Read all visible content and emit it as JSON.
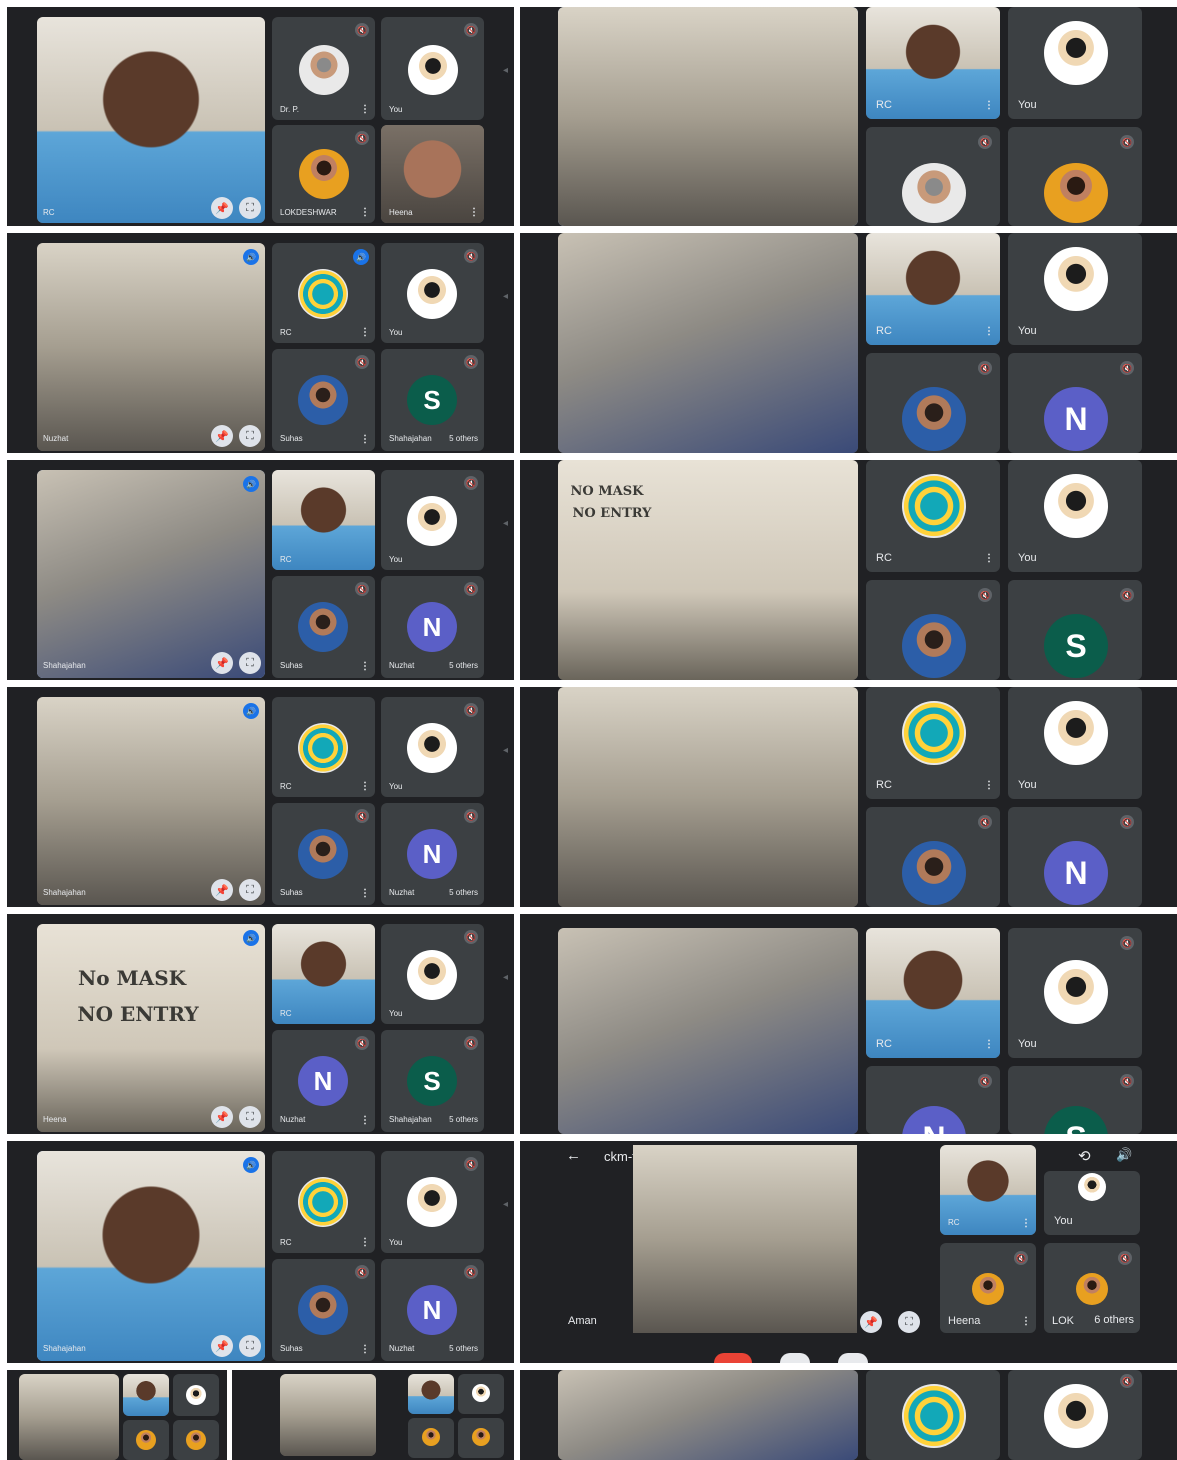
{
  "participants": {
    "rc": "RC",
    "you": "You",
    "dr_p": "Dr. P.",
    "lokdeshwar": "LOKDESHWAR",
    "heena": "Heena",
    "nuzhat": "Nuzhat",
    "suhas": "Suhas",
    "shahajahan": "Shahajahan",
    "aman": "Aman",
    "lok": "LOK"
  },
  "others": {
    "five": "5 others",
    "six": "6 others"
  },
  "avatar_letters": {
    "n": "N",
    "s": "S"
  },
  "meeting": {
    "back_arrow": "←",
    "code": "ckm-tphj-did",
    "code_caret": "▸"
  },
  "signs": {
    "no_mask_line1": "No MASK",
    "no_mask_line2": "NO ENTRY",
    "blur_line1": "NO MASK",
    "blur_line2": "NO ENTRY"
  },
  "icons": {
    "muted": "🔇",
    "more": "⋮",
    "pin": "📌",
    "fullscreen": "⛶",
    "speaking": "🔊",
    "camera_switch": "⟲",
    "volume": "🔊",
    "rail_arrow": "◂"
  },
  "colors": {
    "meet_bg": "#202124",
    "tile_bg": "#3c4043",
    "avatar_n": "#5b5fc7",
    "avatar_s": "#0b5d4b",
    "end_call": "#ea4335",
    "highlight": "#8ab4f8"
  }
}
